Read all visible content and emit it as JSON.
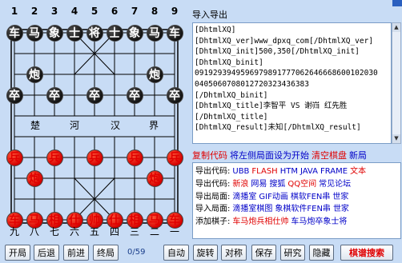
{
  "board": {
    "file_numbers_top": [
      "1",
      "2",
      "3",
      "4",
      "5",
      "6",
      "7",
      "8",
      "9"
    ],
    "file_numbers_bottom": [
      "九",
      "八",
      "七",
      "六",
      "五",
      "四",
      "三",
      "二",
      "一"
    ],
    "river": [
      "楚",
      "河",
      "汉",
      "界"
    ],
    "black_pieces": [
      {
        "char": "车",
        "file": 0,
        "rank": 0
      },
      {
        "char": "马",
        "file": 1,
        "rank": 0
      },
      {
        "char": "象",
        "file": 2,
        "rank": 0
      },
      {
        "char": "士",
        "file": 3,
        "rank": 0
      },
      {
        "char": "将",
        "file": 4,
        "rank": 0
      },
      {
        "char": "士",
        "file": 5,
        "rank": 0
      },
      {
        "char": "象",
        "file": 6,
        "rank": 0
      },
      {
        "char": "马",
        "file": 7,
        "rank": 0
      },
      {
        "char": "车",
        "file": 8,
        "rank": 0
      },
      {
        "char": "炮",
        "file": 1,
        "rank": 2
      },
      {
        "char": "炮",
        "file": 7,
        "rank": 2
      },
      {
        "char": "卒",
        "file": 0,
        "rank": 3
      },
      {
        "char": "卒",
        "file": 2,
        "rank": 3
      },
      {
        "char": "卒",
        "file": 4,
        "rank": 3
      },
      {
        "char": "卒",
        "file": 6,
        "rank": 3
      },
      {
        "char": "卒",
        "file": 8,
        "rank": 3
      }
    ],
    "red_pieces": [
      {
        "char": "兵",
        "file": 0,
        "rank": 6
      },
      {
        "char": "兵",
        "file": 2,
        "rank": 6
      },
      {
        "char": "兵",
        "file": 4,
        "rank": 6
      },
      {
        "char": "兵",
        "file": 6,
        "rank": 6
      },
      {
        "char": "兵",
        "file": 8,
        "rank": 6
      },
      {
        "char": "炮",
        "file": 1,
        "rank": 7
      },
      {
        "char": "炮",
        "file": 7,
        "rank": 7
      },
      {
        "char": "车",
        "file": 0,
        "rank": 9
      },
      {
        "char": "马",
        "file": 1,
        "rank": 9
      },
      {
        "char": "相",
        "file": 2,
        "rank": 9
      },
      {
        "char": "仕",
        "file": 3,
        "rank": 9
      },
      {
        "char": "帅",
        "file": 4,
        "rank": 9
      },
      {
        "char": "仕",
        "file": 5,
        "rank": 9
      },
      {
        "char": "相",
        "file": 6,
        "rank": 9
      },
      {
        "char": "马",
        "file": 7,
        "rank": 9
      },
      {
        "char": "车",
        "file": 8,
        "rank": 9
      }
    ]
  },
  "panel": {
    "title": "导入导出",
    "export_lines": [
      "[DhtmlXQ]",
      "[DhtmlXQ_ver]www_dpxq_com[/DhtmlXQ_ver]",
      "[DhtmlXQ_init]500,350[/DhtmlXQ_init]",
      "[DhtmlXQ_binit]",
      "0919293949596979891777062646668600102030",
      "0405060708012720323436383",
      "[/DhtmlXQ_binit]",
      "[DhtmlXQ_title]李智平 VS 谢岿 红先胜",
      "[/DhtmlXQ_title]",
      "[DhtmlXQ_result]未知[/DhtmlXQ_result]"
    ],
    "actions": [
      {
        "label": "复制代码",
        "color": "red"
      },
      {
        "label": "将左侧局面设为开始",
        "color": "blue"
      },
      {
        "label": "清空棋盘",
        "color": "red"
      },
      {
        "label": "新局",
        "color": "blue"
      }
    ],
    "code_lines": [
      {
        "label": "导出代码:",
        "items": [
          {
            "t": "UBB",
            "c": "blue"
          },
          {
            "t": "FLASH",
            "c": "red"
          },
          {
            "t": "HTM",
            "c": "blue"
          },
          {
            "t": "JAVA",
            "c": "blue"
          },
          {
            "t": "FRAME",
            "c": "blue"
          },
          {
            "t": "文本",
            "c": "red"
          }
        ]
      },
      {
        "label": "导出代码:",
        "items": [
          {
            "t": "新浪",
            "c": "red"
          },
          {
            "t": "网易",
            "c": "blue"
          },
          {
            "t": "搜狐",
            "c": "blue"
          },
          {
            "t": "QQ空间",
            "c": "red"
          },
          {
            "t": "常见论坛",
            "c": "blue"
          }
        ]
      },
      {
        "label": "导出局面:",
        "items": [
          {
            "t": "滴播室",
            "c": "blue"
          },
          {
            "t": "GIF动画",
            "c": "blue"
          },
          {
            "t": "棋软FEN串",
            "c": "blue"
          },
          {
            "t": "世家",
            "c": "blue"
          }
        ]
      },
      {
        "label": "导入局面:",
        "items": [
          {
            "t": "滴播室棋图",
            "c": "blue"
          },
          {
            "t": "象棋软件FEN串",
            "c": "blue"
          },
          {
            "t": "世家",
            "c": "blue"
          }
        ]
      },
      {
        "label": "添加棋子:",
        "items": [
          {
            "t": "车马炮兵相仕帅",
            "c": "red"
          },
          {
            "t": "车马炮卒象士将",
            "c": "blue"
          }
        ]
      }
    ]
  },
  "toolbar": {
    "start": "开局",
    "back": "后退",
    "forward": "前进",
    "end": "终局",
    "counter": "0/59",
    "auto": "自动",
    "rotate": "旋转",
    "mirror": "对称",
    "save": "保存",
    "study": "研究",
    "hide": "隐藏",
    "manual": "棋谱搜索"
  }
}
